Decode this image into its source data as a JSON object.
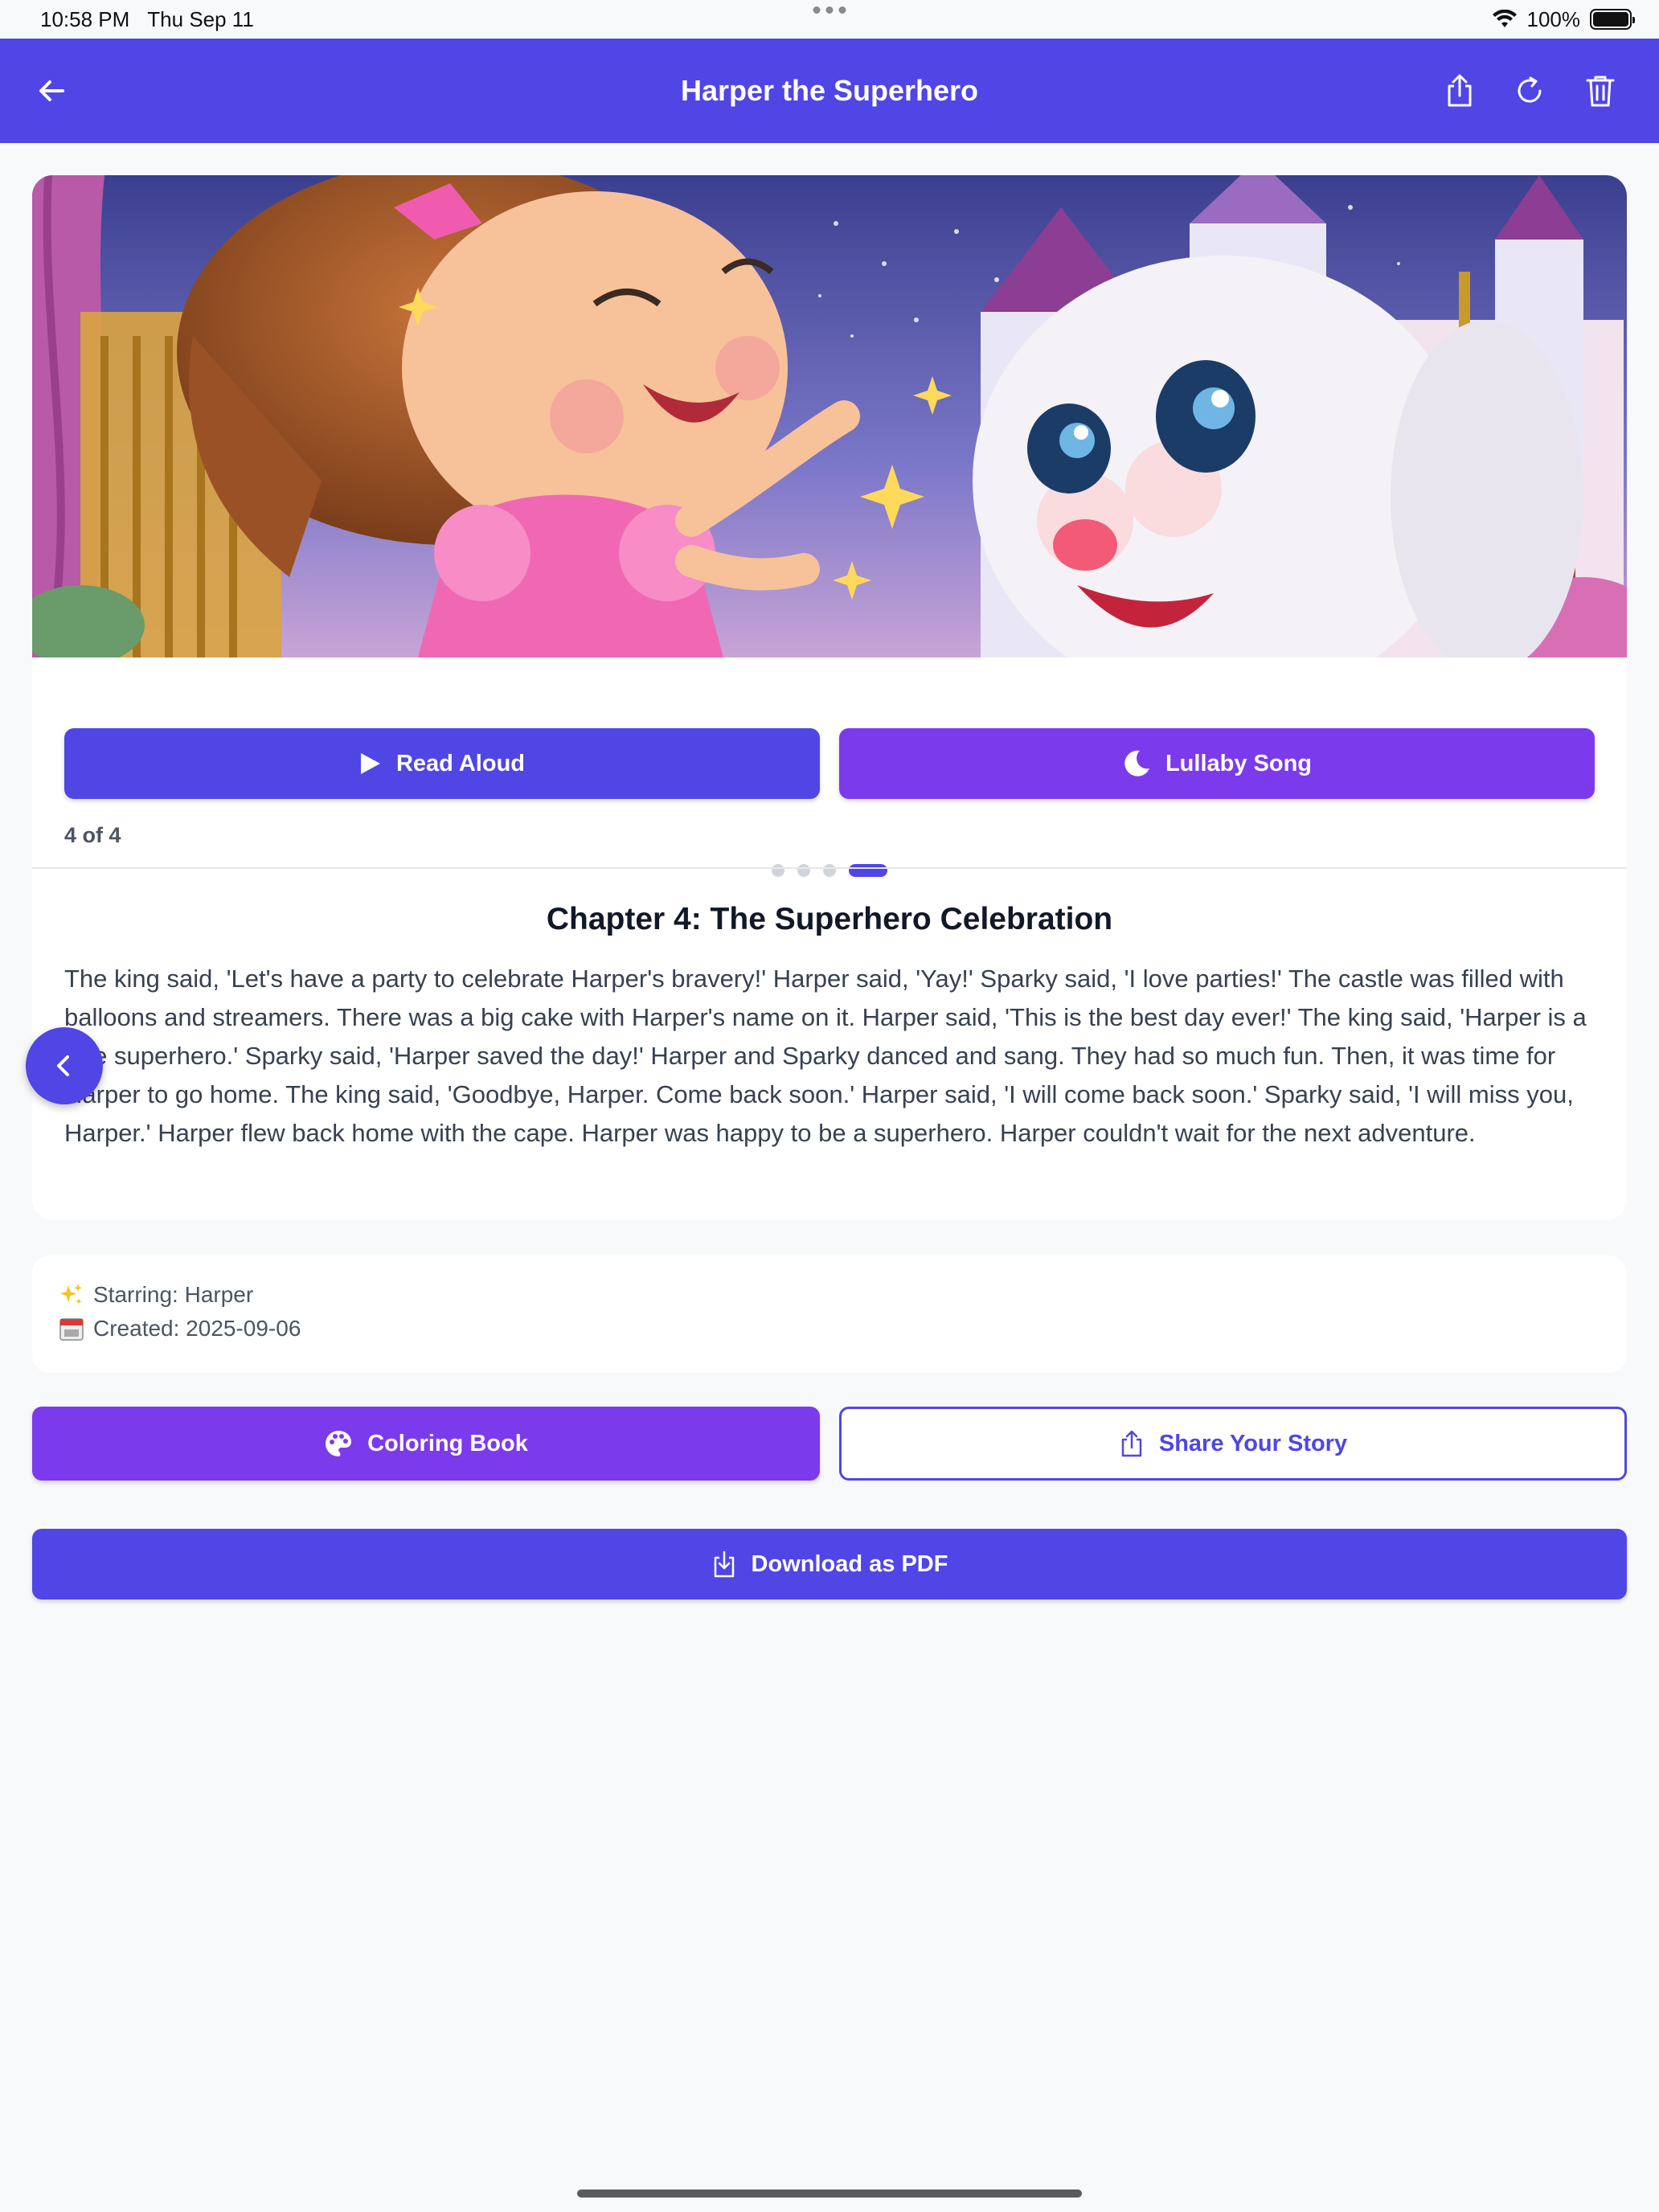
{
  "status_bar": {
    "time": "10:58 PM",
    "date": "Thu Sep 11",
    "battery": "100%"
  },
  "header": {
    "title": "Harper the Superhero"
  },
  "carousel": {
    "total_pages": 4,
    "current_page": 4,
    "page_indicator": "4 of 4"
  },
  "actions": {
    "read_aloud_label": "Read Aloud",
    "lullaby_label": "Lullaby Song"
  },
  "chapter": {
    "title": "Chapter 4: The Superhero Celebration",
    "text": "The king said, 'Let's have a party to celebrate Harper's bravery!' Harper said, 'Yay!' Sparky said, 'I love parties!' The castle was filled with balloons and streamers. There was a big cake with Harper's name on it. Harper said, 'This is the best day ever!' The king said, 'Harper is a true superhero.' Sparky said, 'Harper saved the day!' Harper and Sparky danced and sang. They had so much fun. Then, it was time for Harper to go home. The king said, 'Goodbye, Harper. Come back soon.' Harper said, 'I will come back soon.' Sparky said, 'I will miss you, Harper.' Harper flew back home with the cape. Harper was happy to be a superhero. Harper couldn't wait for the next adventure."
  },
  "meta": {
    "starring": "Starring: Harper",
    "created": "Created: 2025-09-06"
  },
  "bottom_actions": {
    "coloring_label": "Coloring Book",
    "share_label": "Share Your Story",
    "download_label": "Download as PDF"
  },
  "colors": {
    "primary": "#4f46e5",
    "secondary": "#7c3aed",
    "background": "#f8f9fb"
  },
  "icons": [
    "back-arrow-icon",
    "share-icon",
    "refresh-icon",
    "trash-icon",
    "play-icon",
    "moon-icon",
    "sparkles-icon",
    "calendar-icon",
    "palette-icon",
    "download-icon",
    "chevron-left-icon"
  ]
}
